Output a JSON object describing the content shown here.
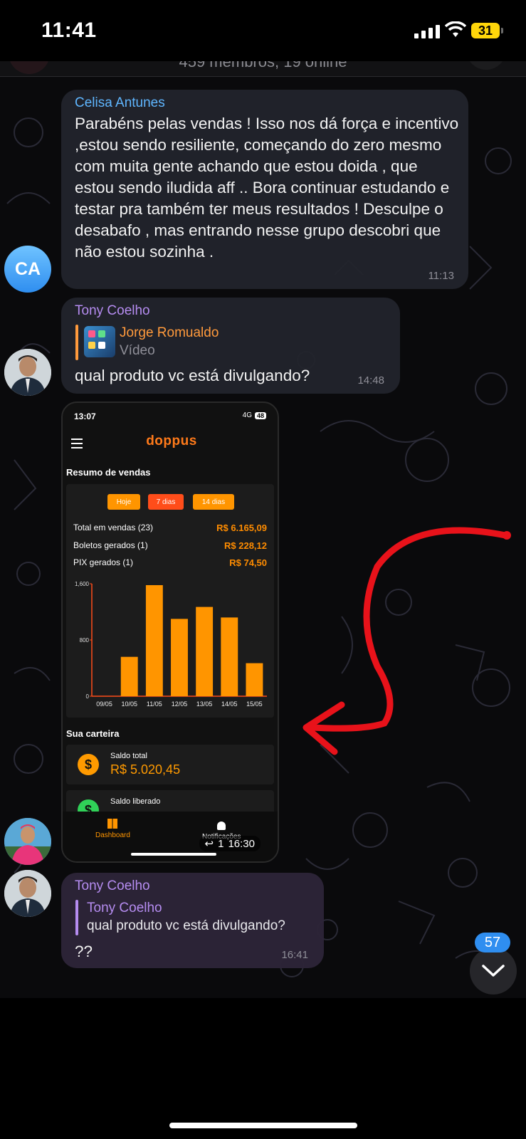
{
  "status_bar": {
    "time": "11:41",
    "battery": "31"
  },
  "chat_header": {
    "subtitle": "459 membros, 19 online"
  },
  "messages": [
    {
      "sender": "Celisa Antunes",
      "sender_color": "#5fb6ff",
      "avatar_initials": "CA",
      "text": "Parabéns pelas vendas ! Isso nos dá força e incentivo ,estou sendo resiliente, começando do zero mesmo com muita gente achando que estou doida , que estou sendo iludida aff .. Bora continuar estudando e testar pra também ter meus resultados ! Desculpe o desabafo , mas entrando nesse grupo descobri que não estou sozinha .",
      "time": "11:13"
    },
    {
      "sender": "Tony Coelho",
      "sender_color": "#b58cf0",
      "reply_to": {
        "sender": "Jorge Romualdo",
        "sender_color": "#ff9a3c",
        "text": "Vídeo"
      },
      "text": "qual produto vc está divulgando?",
      "time": "14:48"
    },
    {
      "type": "image",
      "reply_count": "1",
      "time": "16:30"
    },
    {
      "sender": "Tony Coelho",
      "sender_color": "#b58cf0",
      "reply_to": {
        "sender": "Tony Coelho",
        "sender_color": "#b58cf0",
        "text": "qual produto vc está divulgando?"
      },
      "text": "??",
      "time": "16:41"
    }
  ],
  "screenshot": {
    "time": "13:07",
    "network": "4G",
    "battery": "48",
    "brand": "doppus",
    "summary_title": "Resumo de vendas",
    "filters": [
      "Hoje",
      "7 dias",
      "14 dias"
    ],
    "rows": [
      {
        "label": "Total em vendas (23)",
        "value": "R$ 6.165,09"
      },
      {
        "label": "Boletos gerados (1)",
        "value": "R$ 228,12"
      },
      {
        "label": "PIX gerados (1)",
        "value": "R$ 74,50"
      }
    ],
    "wallet_title": "Sua carteira",
    "wallet": [
      {
        "label": "Saldo total",
        "value": "R$ 5.020,45"
      },
      {
        "label": "Saldo liberado",
        "value": ""
      }
    ],
    "tabs": [
      "Dashboard",
      "Notificações"
    ]
  },
  "chart_data": {
    "type": "bar",
    "categories": [
      "09/05",
      "10/05",
      "11/05",
      "12/05",
      "13/05",
      "14/05",
      "15/05"
    ],
    "values": [
      0,
      560,
      1580,
      1100,
      1270,
      1120,
      470
    ],
    "ylim": [
      0,
      1600
    ],
    "yticks": [
      "0",
      "800",
      "1,600"
    ],
    "title": "",
    "xlabel": "",
    "ylabel": "",
    "bar_color": "#ff9500"
  },
  "unread_count": "57",
  "colors": {
    "accent_orange": "#ff9500",
    "accent_blue": "#2f8ef0",
    "arrow_red": "#e8121a"
  }
}
